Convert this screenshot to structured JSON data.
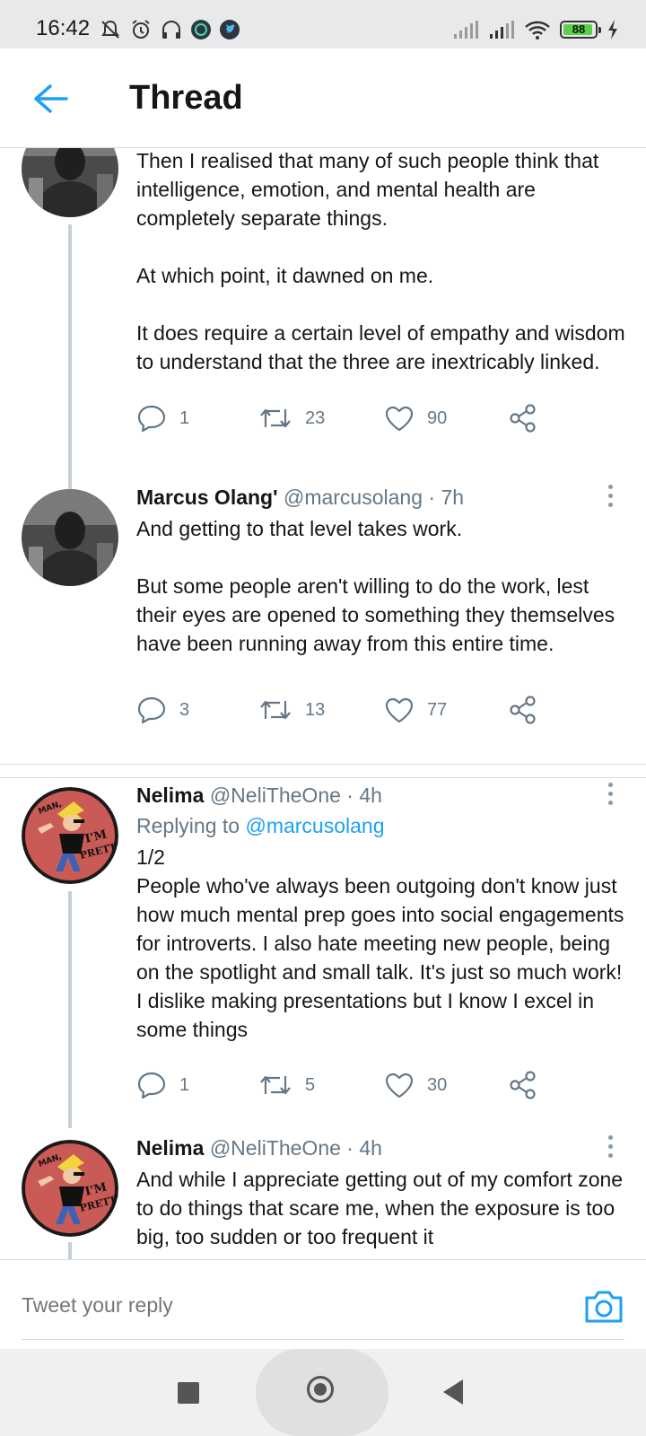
{
  "status_bar": {
    "time": "16:42",
    "battery_level": "88",
    "icons": [
      "mute-icon",
      "alarm-icon",
      "headphones-icon",
      "app-notification-icon",
      "twitter-notification-icon",
      "signal-icon",
      "signal-icon",
      "wifi-icon",
      "battery-icon",
      "charging-icon"
    ]
  },
  "header": {
    "title": "Thread",
    "back_icon": "back-arrow-icon"
  },
  "tweets": [
    {
      "name": "",
      "handle": "",
      "time": "",
      "text": "Then I realised that many of such people think that intelligence, emotion, and mental health are completely separate things.\n\nAt which point, it dawned on me.\n\nIt does require a certain level of empathy and wisdom to understand that the three are inextricably linked.",
      "replies": "1",
      "retweets": "23",
      "likes": "90"
    },
    {
      "name": "Marcus Olang'",
      "handle": "@marcusolang",
      "time": "· 7h",
      "text": "And getting to that level takes work.\n\nBut some people aren't willing to do the work, lest their eyes are opened to something they themselves have been running away from this entire time.",
      "replies": "3",
      "retweets": "13",
      "likes": "77"
    },
    {
      "name": "Nelima",
      "handle": "@NeliTheOne",
      "time": "· 4h",
      "replying_prefix": "Replying to",
      "replying_handle": "@marcusolang",
      "text": "1/2\nPeople who've always been outgoing don't know just how much mental prep goes into social engagements for introverts. I also hate meeting new people, being on the spotlight and small talk. It's just so much work! I dislike making presentations but I know I excel in some things",
      "replies": "1",
      "retweets": "5",
      "likes": "30"
    },
    {
      "name": "Nelima",
      "handle": "@NeliTheOne",
      "time": "· 4h",
      "text": "And while I appreciate getting out of my comfort zone to do things that scare me, when the exposure is too big, too sudden or too frequent it",
      "replies": "",
      "retweets": "",
      "likes": ""
    }
  ],
  "avatar_lettering": {
    "nelima": [
      "MAN,",
      "I'M",
      "PRETTY."
    ]
  },
  "reply_bar": {
    "placeholder": "Tweet your reply",
    "camera_icon": "camera-icon"
  },
  "nav_bar": {
    "icons": [
      "recents-square-icon",
      "home-circle-icon",
      "back-triangle-icon"
    ]
  },
  "colors": {
    "accent": "#1da1f2",
    "secondary_text": "#657786",
    "thread_line": "#c4cfd6",
    "battery_fill": "#5bd04a"
  }
}
